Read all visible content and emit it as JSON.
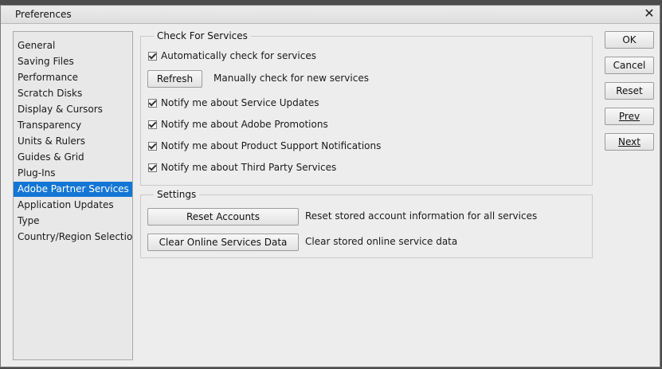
{
  "window": {
    "title": "Preferences"
  },
  "sidebar": {
    "items": [
      {
        "label": "General"
      },
      {
        "label": "Saving Files"
      },
      {
        "label": "Performance"
      },
      {
        "label": "Scratch Disks"
      },
      {
        "label": "Display & Cursors"
      },
      {
        "label": "Transparency"
      },
      {
        "label": "Units & Rulers"
      },
      {
        "label": "Guides & Grid"
      },
      {
        "label": "Plug-Ins"
      },
      {
        "label": "Adobe Partner Services",
        "selected": true
      },
      {
        "label": "Application Updates"
      },
      {
        "label": "Type"
      },
      {
        "label": "Country/Region Selection"
      }
    ]
  },
  "check_for_services": {
    "title": "Check For Services",
    "auto_check": {
      "label": "Automatically check for services",
      "checked": true
    },
    "refresh_button": "Refresh",
    "refresh_desc": "Manually check for new services",
    "notify_updates": {
      "label": "Notify me about Service Updates",
      "checked": true
    },
    "notify_promotions": {
      "label": "Notify me about Adobe Promotions",
      "checked": true
    },
    "notify_support": {
      "label": "Notify me about Product Support Notifications",
      "checked": true
    },
    "notify_third_party": {
      "label": "Notify me about Third Party Services",
      "checked": true
    }
  },
  "settings": {
    "title": "Settings",
    "reset_accounts_button": "Reset Accounts",
    "reset_accounts_desc": "Reset stored account information for all services",
    "clear_data_button": "Clear Online Services Data",
    "clear_data_desc": "Clear stored online service data"
  },
  "buttons": {
    "ok": "OK",
    "cancel": "Cancel",
    "reset": "Reset",
    "prev": "Prev",
    "next": "Next"
  },
  "colors": {
    "selection": "#1476d4",
    "dialog_bg": "#ededed"
  }
}
